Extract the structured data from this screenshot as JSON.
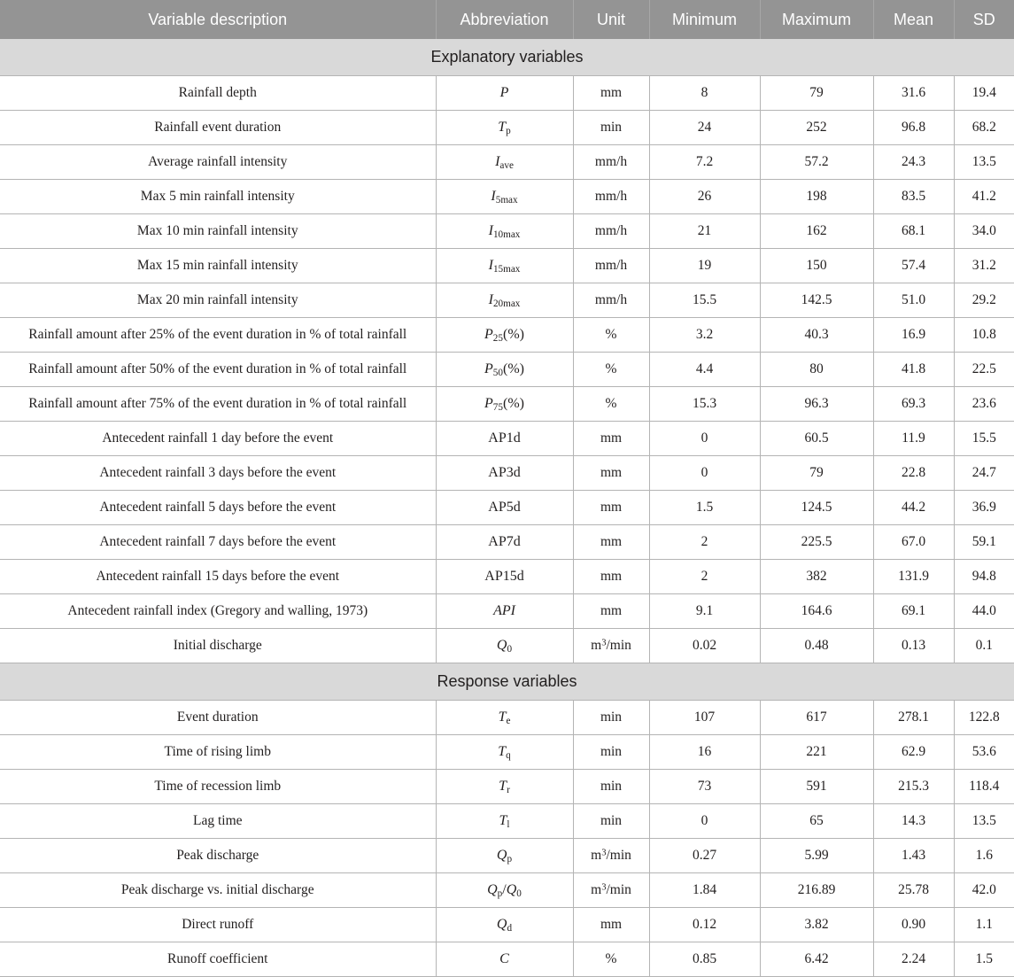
{
  "table": {
    "columns": [
      "Variable description",
      "Abbreviation",
      "Unit",
      "Minimum",
      "Maximum",
      "Mean",
      "SD"
    ],
    "sections": [
      {
        "title": "Explanatory variables",
        "rows": [
          {
            "description": "Rainfall depth",
            "abbreviation": "P",
            "unit": "mm",
            "minimum": "8",
            "maximum": "79",
            "mean": "31.6",
            "sd": "19.4"
          },
          {
            "description": "Rainfall event duration",
            "abbreviation": "Tp",
            "unit": "min",
            "minimum": "24",
            "maximum": "252",
            "mean": "96.8",
            "sd": "68.2"
          },
          {
            "description": "Average rainfall intensity",
            "abbreviation": "Iave",
            "unit": "mm/h",
            "minimum": "7.2",
            "maximum": "57.2",
            "mean": "24.3",
            "sd": "13.5"
          },
          {
            "description": "Max 5 min rainfall intensity",
            "abbreviation": "I5max",
            "unit": "mm/h",
            "minimum": "26",
            "maximum": "198",
            "mean": "83.5",
            "sd": "41.2"
          },
          {
            "description": "Max 10 min rainfall intensity",
            "abbreviation": "I10max",
            "unit": "mm/h",
            "minimum": "21",
            "maximum": "162",
            "mean": "68.1",
            "sd": "34.0"
          },
          {
            "description": "Max 15 min rainfall intensity",
            "abbreviation": "I15max",
            "unit": "mm/h",
            "minimum": "19",
            "maximum": "150",
            "mean": "57.4",
            "sd": "31.2"
          },
          {
            "description": "Max 20 min rainfall intensity",
            "abbreviation": "I20max",
            "unit": "mm/h",
            "minimum": "15.5",
            "maximum": "142.5",
            "mean": "51.0",
            "sd": "29.2"
          },
          {
            "description": "Rainfall amount after 25% of the event duration in % of total rainfall",
            "abbreviation": "P25(%)",
            "unit": "%",
            "minimum": "3.2",
            "maximum": "40.3",
            "mean": "16.9",
            "sd": "10.8"
          },
          {
            "description": "Rainfall amount after 50% of the event duration in % of total rainfall",
            "abbreviation": "P50(%)",
            "unit": "%",
            "minimum": "4.4",
            "maximum": "80",
            "mean": "41.8",
            "sd": "22.5"
          },
          {
            "description": "Rainfall amount after 75% of the event duration in % of total rainfall",
            "abbreviation": "P75(%)",
            "unit": "%",
            "minimum": "15.3",
            "maximum": "96.3",
            "mean": "69.3",
            "sd": "23.6"
          },
          {
            "description": "Antecedent rainfall 1 day before the event",
            "abbreviation": "AP1d",
            "unit": "mm",
            "minimum": "0",
            "maximum": "60.5",
            "mean": "11.9",
            "sd": "15.5"
          },
          {
            "description": "Antecedent rainfall 3 days before the event",
            "abbreviation": "AP3d",
            "unit": "mm",
            "minimum": "0",
            "maximum": "79",
            "mean": "22.8",
            "sd": "24.7"
          },
          {
            "description": "Antecedent rainfall 5 days before the event",
            "abbreviation": "AP5d",
            "unit": "mm",
            "minimum": "1.5",
            "maximum": "124.5",
            "mean": "44.2",
            "sd": "36.9"
          },
          {
            "description": "Antecedent rainfall 7 days before the event",
            "abbreviation": "AP7d",
            "unit": "mm",
            "minimum": "2",
            "maximum": "225.5",
            "mean": "67.0",
            "sd": "59.1"
          },
          {
            "description": "Antecedent rainfall 15 days before the event",
            "abbreviation": "AP15d",
            "unit": "mm",
            "minimum": "2",
            "maximum": "382",
            "mean": "131.9",
            "sd": "94.8"
          },
          {
            "description": "Antecedent rainfall index (Gregory and walling, 1973)",
            "abbreviation": "API",
            "unit": "mm",
            "minimum": "9.1",
            "maximum": "164.6",
            "mean": "69.1",
            "sd": "44.0"
          },
          {
            "description": "Initial discharge",
            "abbreviation": "Q0",
            "unit": "m3/min",
            "minimum": "0.02",
            "maximum": "0.48",
            "mean": "0.13",
            "sd": "0.1"
          }
        ]
      },
      {
        "title": "Response variables",
        "rows": [
          {
            "description": "Event duration",
            "abbreviation": "Te",
            "unit": "min",
            "minimum": "107",
            "maximum": "617",
            "mean": "278.1",
            "sd": "122.8"
          },
          {
            "description": "Time of rising limb",
            "abbreviation": "Tq",
            "unit": "min",
            "minimum": "16",
            "maximum": "221",
            "mean": "62.9",
            "sd": "53.6"
          },
          {
            "description": "Time of recession limb",
            "abbreviation": "Tr",
            "unit": "min",
            "minimum": "73",
            "maximum": "591",
            "mean": "215.3",
            "sd": "118.4"
          },
          {
            "description": "Lag time",
            "abbreviation": "Tl",
            "unit": "min",
            "minimum": "0",
            "maximum": "65",
            "mean": "14.3",
            "sd": "13.5"
          },
          {
            "description": "Peak discharge",
            "abbreviation": "Qp",
            "unit": "m3/min",
            "minimum": "0.27",
            "maximum": "5.99",
            "mean": "1.43",
            "sd": "1.6"
          },
          {
            "description": "Peak discharge vs. initial discharge",
            "abbreviation": "Qp/Q0",
            "unit": "m3/min",
            "minimum": "1.84",
            "maximum": "216.89",
            "mean": "25.78",
            "sd": "42.0"
          },
          {
            "description": "Direct runoff",
            "abbreviation": "Qd",
            "unit": "mm",
            "minimum": "0.12",
            "maximum": "3.82",
            "mean": "0.90",
            "sd": "1.1"
          },
          {
            "description": "Runoff coefficient",
            "abbreviation": "C",
            "unit": "%",
            "minimum": "0.85",
            "maximum": "6.42",
            "mean": "2.24",
            "sd": "1.5"
          }
        ]
      }
    ],
    "abbreviation_markup": {
      "P": "<i class=\"v\">P</i>",
      "Tp": "<i class=\"v\">T</i><sub>p</sub>",
      "Iave": "<i class=\"v\">I</i><sub>ave</sub>",
      "I5max": "<i class=\"v\">I</i><sub>5max</sub>",
      "I10max": "<i class=\"v\">I</i><sub>10max</sub>",
      "I15max": "<i class=\"v\">I</i><sub>15max</sub>",
      "I20max": "<i class=\"v\">I</i><sub>20max</sub>",
      "P25(%)": "<i class=\"v\">P</i><sub>25</sub>(%)",
      "P50(%)": "<i class=\"v\">P</i><sub>50</sub>(%)",
      "P75(%)": "<i class=\"v\">P</i><sub>75</sub>(%)",
      "AP1d": "AP1d",
      "AP3d": "AP3d",
      "AP5d": "AP5d",
      "AP7d": "AP7d",
      "AP15d": "AP15d",
      "API": "<i class=\"v\">API</i>",
      "Q0": "<i class=\"v\">Q</i><sub>0</sub>",
      "Te": "<i class=\"v\">T</i><sub>e</sub>",
      "Tq": "<i class=\"v\">T</i><sub>q</sub>",
      "Tr": "<i class=\"v\">T</i><sub>r</sub>",
      "Tl": "<i class=\"v\">T</i><sub>l</sub>",
      "Qp": "<i class=\"v\">Q</i><sub>p</sub>",
      "Qp/Q0": "<i class=\"v\">Q</i><sub>p</sub>/<i class=\"v\">Q</i><sub>0</sub>",
      "Qd": "<i class=\"v\">Q</i><sub>d</sub>",
      "C": "<i class=\"v\">C</i>"
    },
    "unit_markup": {
      "mm": "mm",
      "min": "min",
      "mm/h": "mm/h",
      "%": "%",
      "m3/min": "m<sup>3</sup>/min"
    }
  },
  "colors": {
    "header_background": "#949494",
    "header_text": "#ffffff",
    "section_background": "#d9d9d9",
    "body_background": "#ffffff",
    "grid_line": "#b4b4b4",
    "text": "#221f1f"
  }
}
